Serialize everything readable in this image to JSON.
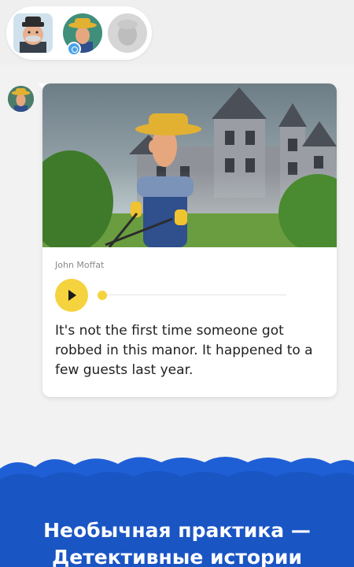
{
  "story": {
    "speaker_name": "John Moffat",
    "message": "It's not the first time someone got robbed in this manor. It happened to a few guests last year.",
    "audio_progress": 0
  },
  "promo": {
    "title_line1": "Необычная практика —",
    "title_line2": "Детективные истории",
    "color": "#1f5fd6"
  },
  "colors": {
    "accent": "#f5d33f"
  },
  "icons": {
    "play": "play-icon",
    "verified": "badge-icon"
  }
}
